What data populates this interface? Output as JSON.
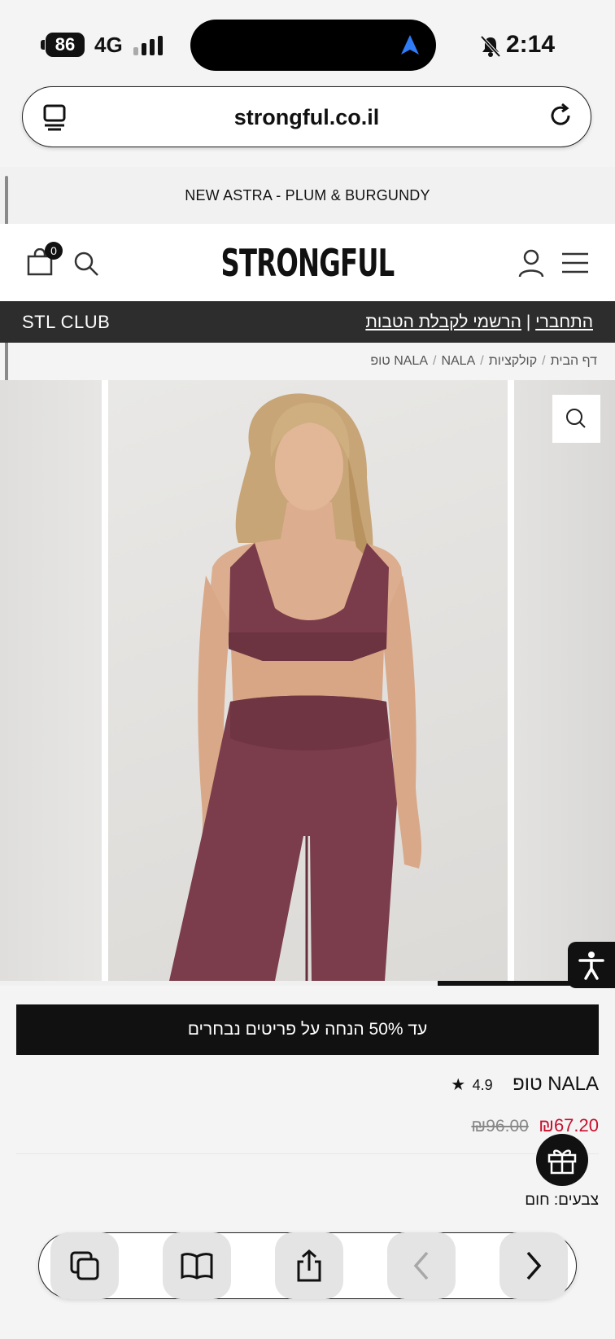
{
  "status_bar": {
    "battery": "86",
    "network": "4G",
    "time": "2:14"
  },
  "browser": {
    "url": "strongful.co.il"
  },
  "announcement": "NEW ASTRA - PLUM & BURGUNDY",
  "header": {
    "logo": "STRONGFUL",
    "cart_count": "0"
  },
  "club_bar": {
    "left_label": "STL CLUB",
    "login": "התחברי",
    "separator": "|",
    "signup": "הרשמי לקבלת הטבות"
  },
  "breadcrumb": [
    "דף הבית",
    "קולקציות",
    "NALA",
    "NALA טופ"
  ],
  "gallery": {
    "progress": 0.29
  },
  "product": {
    "promo": "עד 50% הנחה על פריטים נבחרים",
    "title": "NALA טופ",
    "rating": "4.9",
    "price_new": "₪67.20",
    "price_old": "₪96.00",
    "colors_label": "צבעים:",
    "colors_value": "חום"
  },
  "colors": {
    "accent_price": "#c8102e",
    "club_bar": "#2d2d2d",
    "product_fabric": "#7a3c4b"
  },
  "icons": [
    "reader-icon",
    "reload-icon",
    "cart-icon",
    "search-icon",
    "user-icon",
    "menu-icon",
    "zoom-icon",
    "accessibility-icon",
    "gift-icon",
    "tabs-icon",
    "bookmarks-icon",
    "share-icon",
    "back-icon",
    "forward-icon"
  ]
}
